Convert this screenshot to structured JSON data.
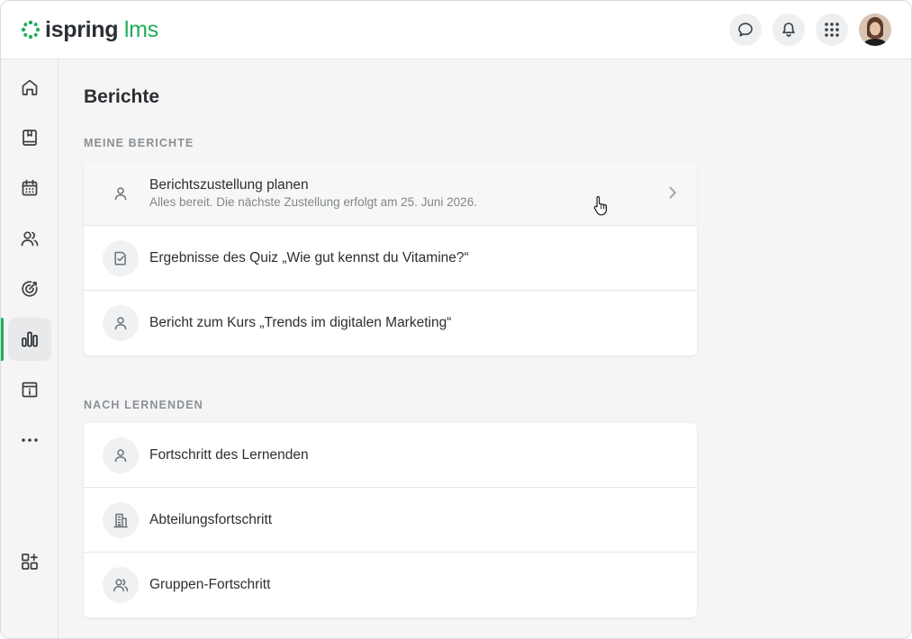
{
  "brand": {
    "name_part1": "ispring",
    "name_part2": "lms",
    "accent_color": "#1fae58"
  },
  "topbar": {
    "icons": [
      "chat-icon",
      "bell-icon",
      "apps-grid-icon"
    ],
    "avatar": "user-avatar"
  },
  "sidebar": {
    "items": [
      {
        "icon": "home-icon",
        "active": false
      },
      {
        "icon": "book-icon",
        "active": false
      },
      {
        "icon": "calendar-icon",
        "active": false
      },
      {
        "icon": "users-icon",
        "active": false
      },
      {
        "icon": "target-icon",
        "active": false
      },
      {
        "icon": "bar-chart-icon",
        "active": true
      },
      {
        "icon": "info-archive-icon",
        "active": false
      },
      {
        "icon": "more-icon",
        "active": false
      },
      {
        "icon": "add-widget-icon",
        "active": false
      }
    ]
  },
  "page": {
    "title": "Berichte"
  },
  "sections": [
    {
      "label": "MEINE BERICHTE",
      "rows": [
        {
          "icon": "user-icon",
          "title": "Berichtszustellung planen",
          "subtitle": "Alles bereit. Die nächste Zustellung erfolgt am 25. Juni 2026."
        },
        {
          "icon": "quiz-check-icon",
          "title": "Ergebnisse des Quiz „Wie gut kennst du Vitamine?“"
        },
        {
          "icon": "user-icon",
          "title": "Bericht zum Kurs „Trends im digitalen Marketing“"
        }
      ]
    },
    {
      "label": "NACH LERNENDEN",
      "rows": [
        {
          "icon": "user-icon",
          "title": "Fortschritt des Lernenden"
        },
        {
          "icon": "building-icon",
          "title": "Abteilungsfortschritt"
        },
        {
          "icon": "group-icon",
          "title": "Gruppen-Fortschritt"
        }
      ]
    }
  ]
}
